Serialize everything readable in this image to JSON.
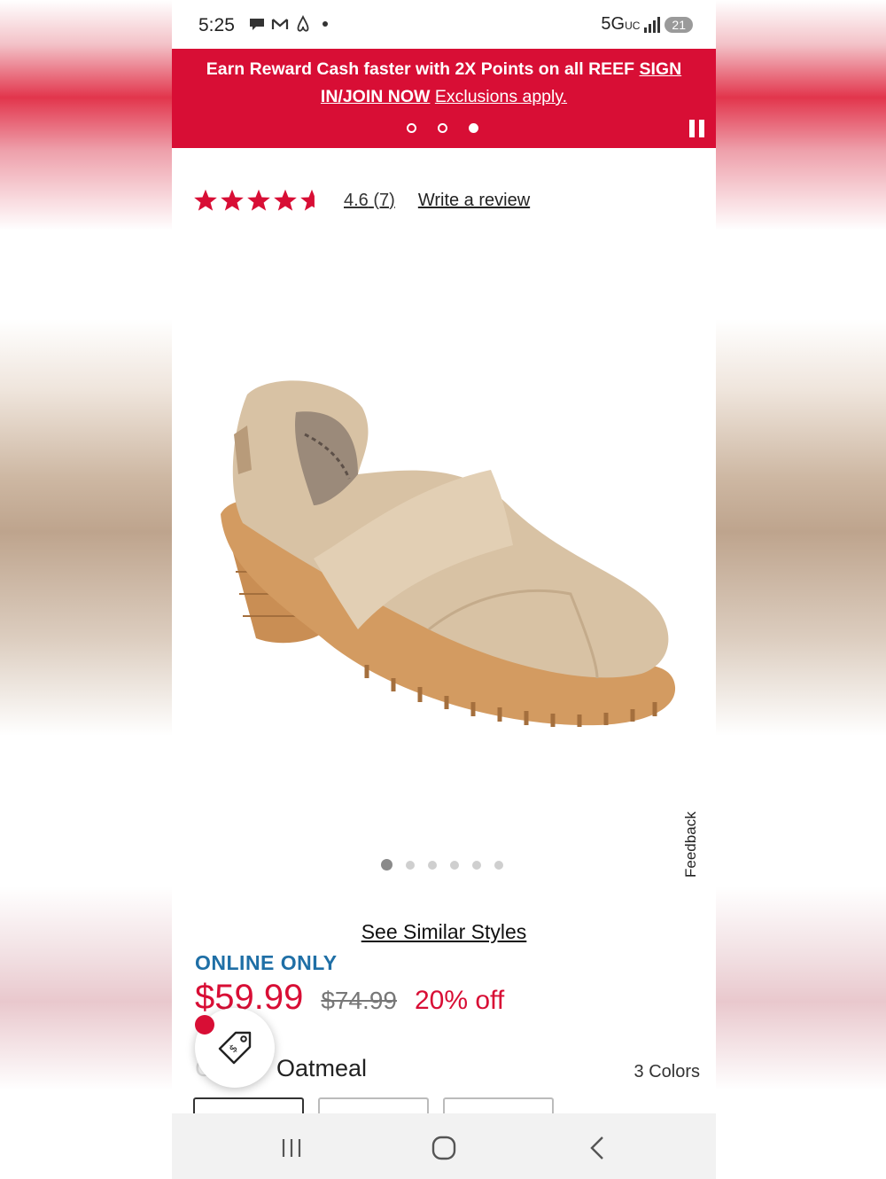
{
  "status_bar": {
    "time": "5:25",
    "icons": [
      "chat-icon",
      "gmail-icon",
      "airbnb-icon",
      "notification-dot"
    ],
    "network": "5G",
    "network_sub": "UC",
    "battery": "21"
  },
  "promo": {
    "text_bold": "Earn Reward Cash faster with 2X Points on all REEF ",
    "link": "SIGN IN/JOIN NOW",
    "exclusions": "Exclusions apply.",
    "slides": 3,
    "active_slide": 3,
    "bg_color": "#d80e35"
  },
  "rating": {
    "stars": 4.6,
    "value": "4.6",
    "count": "(7)",
    "write_review": "Write a review",
    "star_color": "#d80e35"
  },
  "product": {
    "image_icon": "oatmeal-heeled-loafer-shoe",
    "image_count": 6,
    "active_image": 1,
    "feedback": "Feedback",
    "see_similar": "See Similar Styles",
    "online_only": "ONLINE ONLY",
    "price": "$59.99",
    "original_price": "$74.99",
    "discount": "20% off",
    "color_label": "Color:",
    "color_value": "Oatmeal",
    "colors_count": "3 Colors"
  },
  "nav": {
    "icons": [
      "recents-icon",
      "home-icon",
      "back-icon"
    ]
  }
}
